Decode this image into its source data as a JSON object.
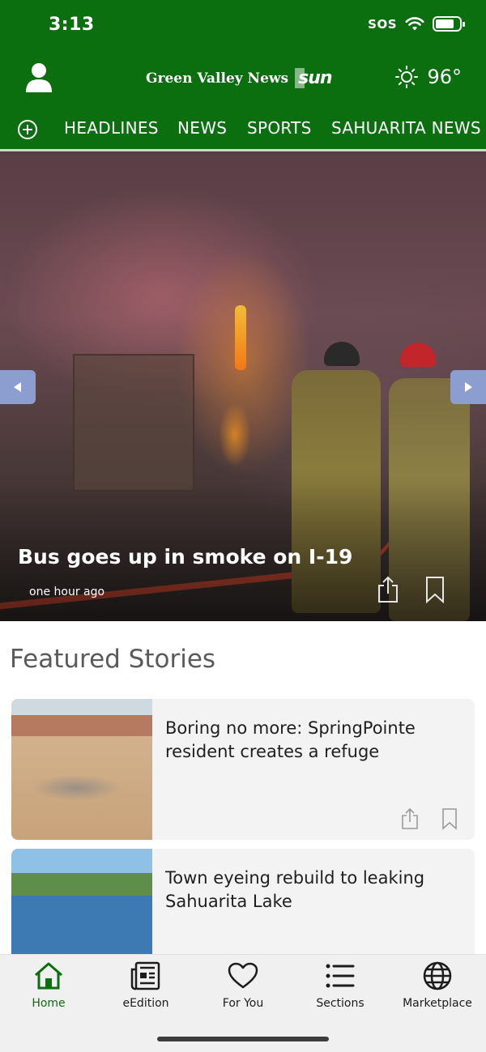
{
  "status_bar": {
    "time": "3:13",
    "sos": "SOS"
  },
  "header": {
    "masthead_text": "Green Valley News",
    "masthead_logo": "sun",
    "temperature": "96°"
  },
  "nav": {
    "items": [
      "HEADLINES",
      "NEWS",
      "SPORTS",
      "SAHUARITA NEWS"
    ]
  },
  "hero": {
    "title": "Bus goes up in smoke on I-19",
    "timestamp": "one hour ago"
  },
  "featured": {
    "heading": "Featured Stories",
    "stories": [
      {
        "title": "Boring no more: SpringPointe resident creates a refuge"
      },
      {
        "title": "Town eyeing rebuild to leaking Sahuarita Lake"
      }
    ]
  },
  "tabbar": {
    "tabs": [
      {
        "label": "Home",
        "icon": "home-icon",
        "active": true
      },
      {
        "label": "eEdition",
        "icon": "newspaper-icon",
        "active": false
      },
      {
        "label": "For You",
        "icon": "heart-icon",
        "active": false
      },
      {
        "label": "Sections",
        "icon": "list-icon",
        "active": false
      },
      {
        "label": "Marketplace",
        "icon": "globe-icon",
        "active": false
      }
    ]
  },
  "colors": {
    "brand_green": "#0b6e0f",
    "arrow_button": "#8c9dcf"
  }
}
